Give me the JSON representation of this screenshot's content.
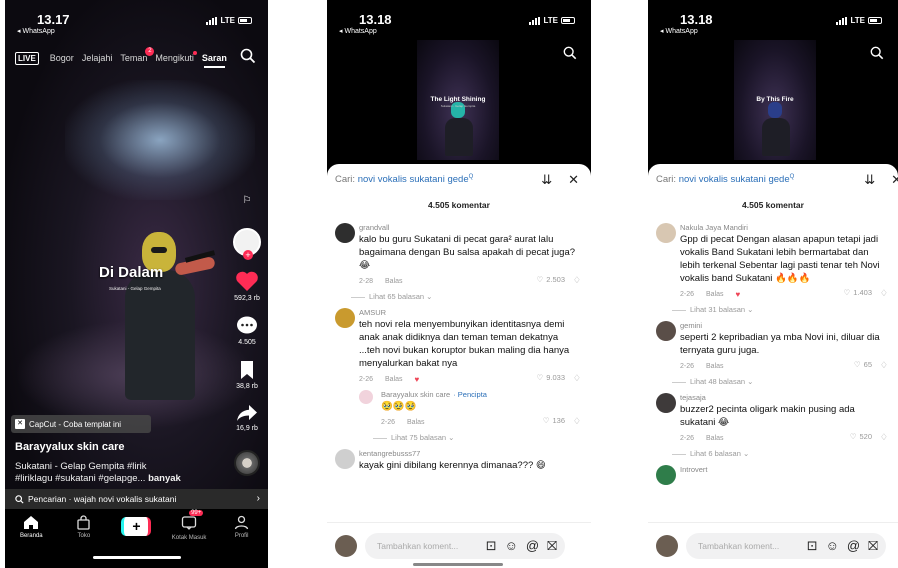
{
  "panel1": {
    "status": {
      "time": "13.17",
      "back": "◂ WhatsApp",
      "net": "LTE"
    },
    "live": "LIVE",
    "nav": [
      {
        "label": "Bogor",
        "badge": ""
      },
      {
        "label": "Jelajahi",
        "badge": ""
      },
      {
        "label": "Teman",
        "badge": "2"
      },
      {
        "label": "Mengikuti",
        "badge": ""
      },
      {
        "label": "Saran",
        "badge": ""
      }
    ],
    "video_title": "Di Dalam",
    "video_subtitle": "Sukatani - Gelap Gempita",
    "likes": "592,3 rb",
    "comments": "4.505",
    "saves": "38,8 rb",
    "shares": "16,9 rb",
    "capcut": "CapCut - Coba templat ini",
    "author": "Barayyalux skin care",
    "caption_line1": "Sukatani - Gelap Gempita #lirik",
    "caption_line2": "#liriklagu #sukatani #gelapge...",
    "caption_more": "banyak",
    "search_prompt": "Pencarian · wajah novi vokalis sukatani",
    "tabs": {
      "home": "Beranda",
      "shop": "Toko",
      "inbox": "Kotak Masuk",
      "inbox_badge": "99+",
      "profile": "Profil"
    },
    "colors": {
      "accent": "#fe2c55",
      "cyan": "#25f4ee"
    }
  },
  "panel2": {
    "status": {
      "time": "13.18",
      "back": "◂ WhatsApp",
      "net": "LTE"
    },
    "video_title": "The Light Shining",
    "video_subtitle": "Sukatani - Gelap Gempita",
    "search_label": "Cari:",
    "search_query": "novi vokalis sukatani gede",
    "comment_count": "4.505 komentar",
    "comments": [
      {
        "user": "grandvall",
        "text": "kalo bu guru Sukatani di pecat gara² aurat lalu bagaimana dengan Bu salsa apakah di pecat juga? 😂",
        "date": "2-28",
        "reply": "Balas",
        "likes": "2.503",
        "more": "Lihat 65 balasan ⌄"
      },
      {
        "user": "AMSUR",
        "text": "teh novi rela menyembunyikan identitasnya demi anak anak didiknya dan teman teman dekatnya ...teh novi bukan koruptor bukan maling dia hanya menyalurkan bakat nya",
        "date": "2-26",
        "reply": "Balas",
        "likes": "9.033",
        "more": ""
      },
      {
        "user": "Barayyalux skin care",
        "badge": "· Pencipta",
        "text": "🥹🥹🥹",
        "date": "2-26",
        "reply": "Balas",
        "likes": "136",
        "more": "Lihat 75 balasan ⌄"
      },
      {
        "user": "kentangrebusss77",
        "text": "kayak gini dibilang kerennya dimanaa??? 😄",
        "date": "",
        "reply": "",
        "likes": "",
        "more": ""
      }
    ],
    "composer_placeholder": "Tambahkan koment..."
  },
  "panel3": {
    "status": {
      "time": "13.18",
      "back": "◂ WhatsApp",
      "net": "LTE"
    },
    "video_title": "By This Fire",
    "search_label": "Cari:",
    "search_query": "novi vokalis sukatani gede",
    "comment_count": "4.505 komentar",
    "comments": [
      {
        "user": "Nakula Jaya Mandiri",
        "text": "Gpp di pecat Dengan alasan apapun tetapi jadi vokalis Band Sukatani lebih bermartabat dan lebih terkenal Sebentar lagi pasti tenar teh Novi vokalis band Sukatani 🔥🔥🔥",
        "date": "2-26",
        "reply": "Balas",
        "likes": "1.403",
        "more": "Lihat 31 balasan ⌄"
      },
      {
        "user": "gemini",
        "text": "seperti 2 kepribadian ya mba Novi ini, diluar dia ternyata guru juga.",
        "date": "2-26",
        "reply": "Balas",
        "likes": "65",
        "more": "Lihat 48 balasan ⌄"
      },
      {
        "user": "tejasaja",
        "text": "buzzer2 pecinta oligark makin pusing ada sukatani 😂",
        "date": "2-26",
        "reply": "Balas",
        "likes": "520",
        "more": "Lihat 6 balasan ⌄"
      },
      {
        "user": "Introvert",
        "text": "",
        "date": "",
        "reply": "",
        "likes": "",
        "more": ""
      }
    ],
    "composer_placeholder": "Tambahkan koment..."
  }
}
